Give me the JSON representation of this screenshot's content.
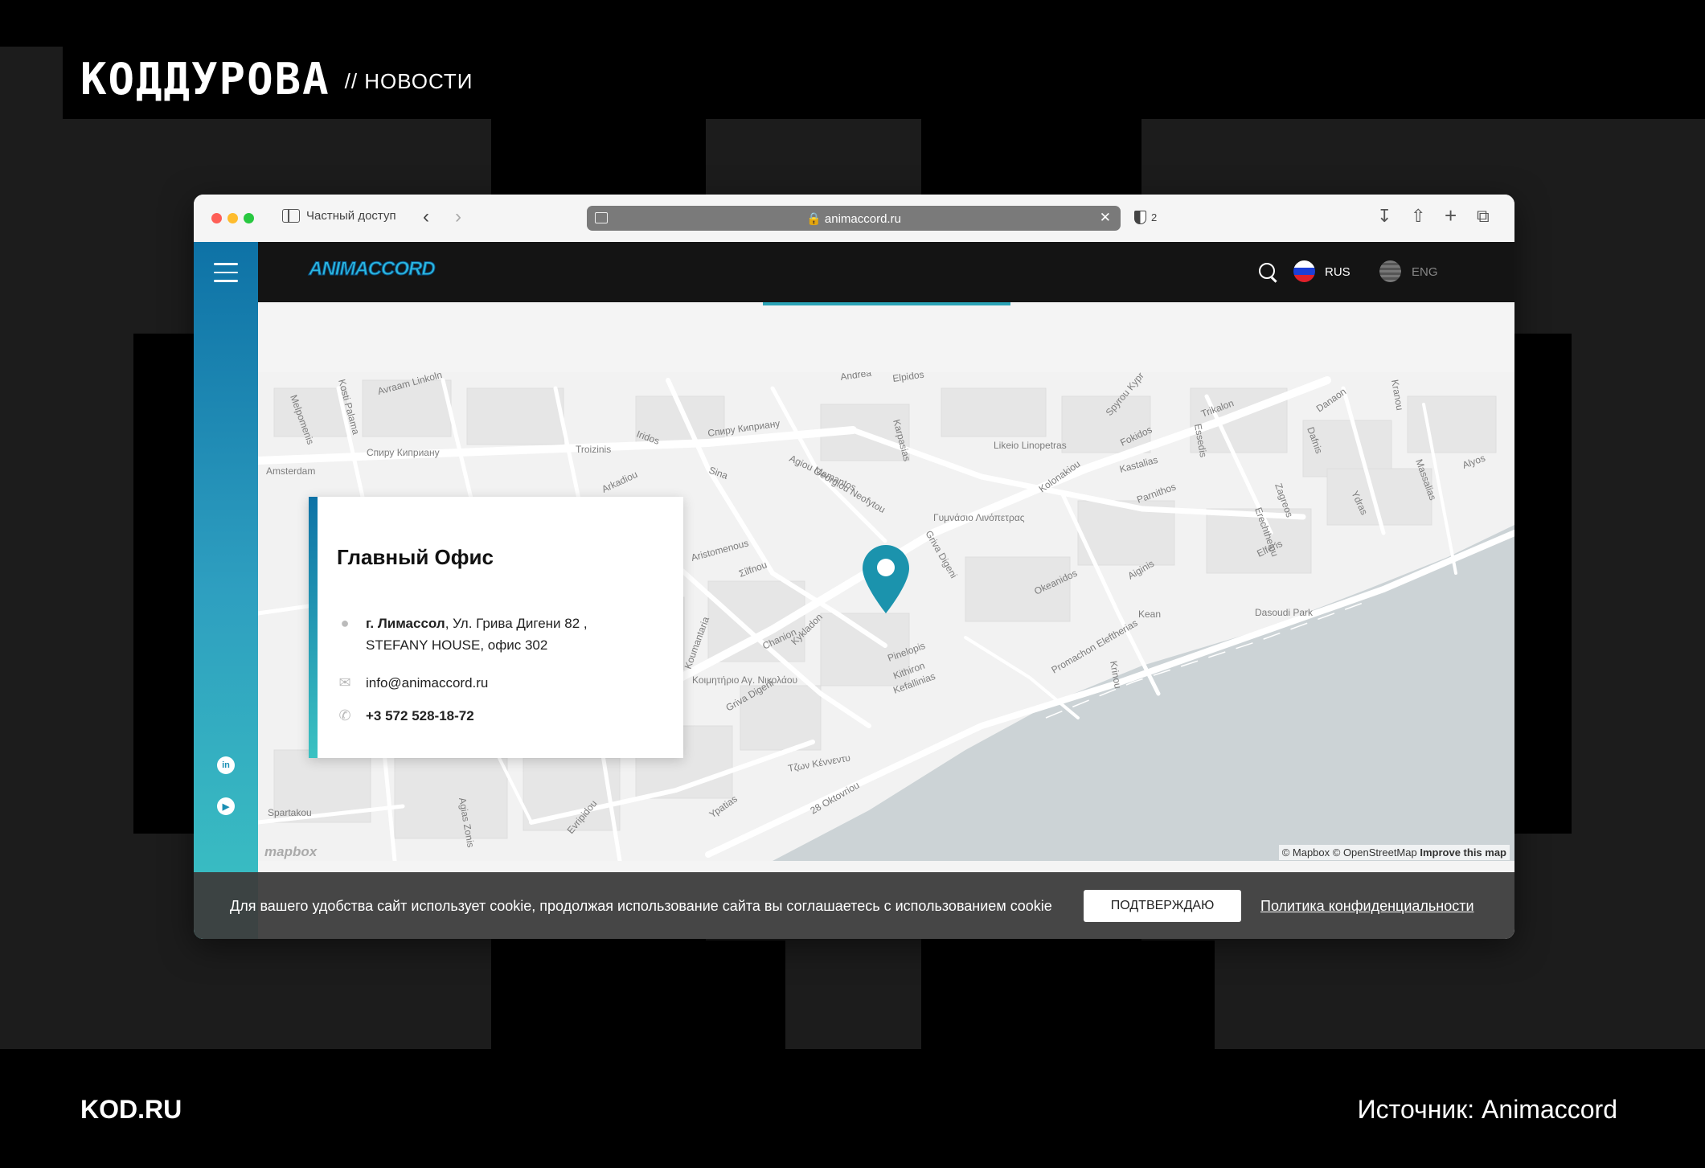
{
  "brand": {
    "logo": "КОДДУРОВА",
    "section": "// НОВОСТИ"
  },
  "footer": {
    "site": "KOD.RU",
    "source": "Источник: Animaccord"
  },
  "browser": {
    "private_label": "Частный доступ",
    "url": "🔒 animaccord.ru",
    "shield_count": "2"
  },
  "site": {
    "logo": "ANIMACCORD",
    "languages": [
      {
        "label": "RUS",
        "active": true
      },
      {
        "label": "ENG",
        "active": false
      }
    ]
  },
  "office": {
    "title": "Главный Офис",
    "city": "г. Лимассол",
    "address_line1": ", Ул. Грива Дигени 82 ,",
    "address_line2": "STEFANY HOUSE, офис 302",
    "email": "info@animaccord.ru",
    "phone": "+3 572 528-18-72"
  },
  "map": {
    "attribution": "© Mapbox © OpenStreetMap",
    "improve": "Improve this map",
    "mapbox_logo": "mapbox",
    "streets": [
      "Спиру Киприану",
      "Спиру Киприану",
      "Griva Digeni",
      "Griva Digeni",
      "Promachon Eleftherias",
      "28 Oktovriou",
      "Τζων Κέννεντυ",
      "Georgiou Neofytou",
      "Kolonakiou",
      "Likeio Linopetras",
      "Γυμνάσιο Λινόπετρας",
      "Dasoudi Park",
      "Kean",
      "Okeanidos",
      "Aiginis",
      "Kastalias",
      "Parnithos",
      "Fokidos",
      "Trikalon",
      "Pinelopis",
      "Kithiron",
      "Kefallinias",
      "Chanion",
      "Kykladon",
      "Σίlfnou",
      "Aristomenous",
      "Troizinis",
      "Amsterdam",
      "Spartakou",
      "Agias Zonis",
      "Ypatias",
      "Evripidou",
      "Koumantaria",
      "Κοιμητήριο Αγ. Νικολάου",
      "Andrea",
      "Elpidos",
      "Karpasias",
      "Agiou Mamantos",
      "Sina",
      "Arkadiou",
      "Iridos",
      "Elferis",
      "Ydras",
      "Zagreos",
      "Erechtheiou",
      "Massalias",
      "Alyos",
      "Kranou",
      "Danaon",
      "Dafnis",
      "Spyrou Kypr",
      "Essedis",
      "Krinou",
      "Kosti Palama",
      "Melpomenis",
      "Avraam Linkoln"
    ],
    "colors": {
      "accent": "#1a8fb4",
      "land": "#f2f2f2",
      "water": "#ccd3d6",
      "marker": "#1b93ad"
    }
  },
  "cookie": {
    "text": "Для вашего удобства сайт использует cookie, продолжая использование сайта вы соглашаетесь с использованием cookie",
    "button": "ПОДТВЕРЖДАЮ",
    "link": "Политика конфиденциальности"
  }
}
